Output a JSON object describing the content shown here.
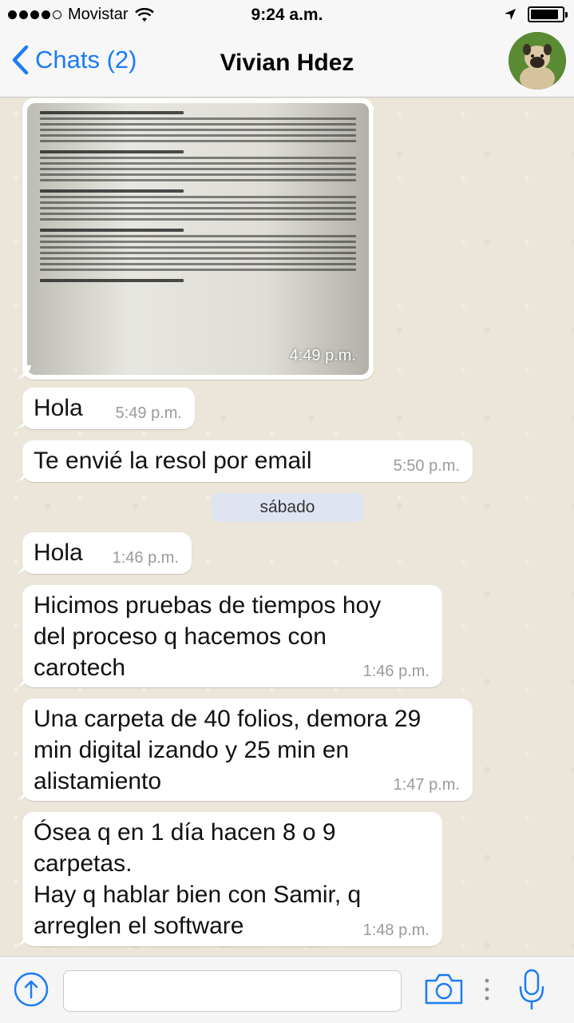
{
  "status_bar": {
    "carrier": "Movistar",
    "time": "9:24 a.m.",
    "signal_bars": 4,
    "signal_bars_total": 5,
    "battery_level": 0.9
  },
  "header": {
    "back_label": "Chats (2)",
    "contact_name": "Vivian Hdez",
    "avatar_icon": "pug-photo"
  },
  "messages": {
    "image": {
      "time": "4:49 p.m.",
      "icon": "document-photo"
    },
    "m1": {
      "text": "Hola",
      "time": "5:49 p.m."
    },
    "m2": {
      "text": "Te envié la resol por email",
      "time": "5:50 p.m."
    },
    "date_divider": "sábado",
    "m3": {
      "text": "Hola",
      "time": "1:46 p.m."
    },
    "m4": {
      "text": "Hicimos pruebas de tiempos hoy\ndel proceso q hacemos con\ncarotech",
      "time": "1:46 p.m."
    },
    "m5": {
      "text": "Una carpeta de 40 folios, demora 29\nmin digital izando y 25 min en\nalistamiento",
      "time": "1:47 p.m."
    },
    "m6": {
      "text": "Ósea q en 1 día hacen 8 o 9\ncarpetas.\nHay q hablar bien con Samir, q\narreglen el software",
      "time": "1:48 p.m."
    }
  },
  "input_bar": {
    "placeholder": "",
    "icons": [
      "upload-icon",
      "camera-icon",
      "more-icon",
      "microphone-icon"
    ]
  },
  "colors": {
    "accent": "#1c7cf4",
    "bubble": "#ffffff",
    "chat_background": "#ece6da",
    "date_chip": "#dfe4f3"
  }
}
